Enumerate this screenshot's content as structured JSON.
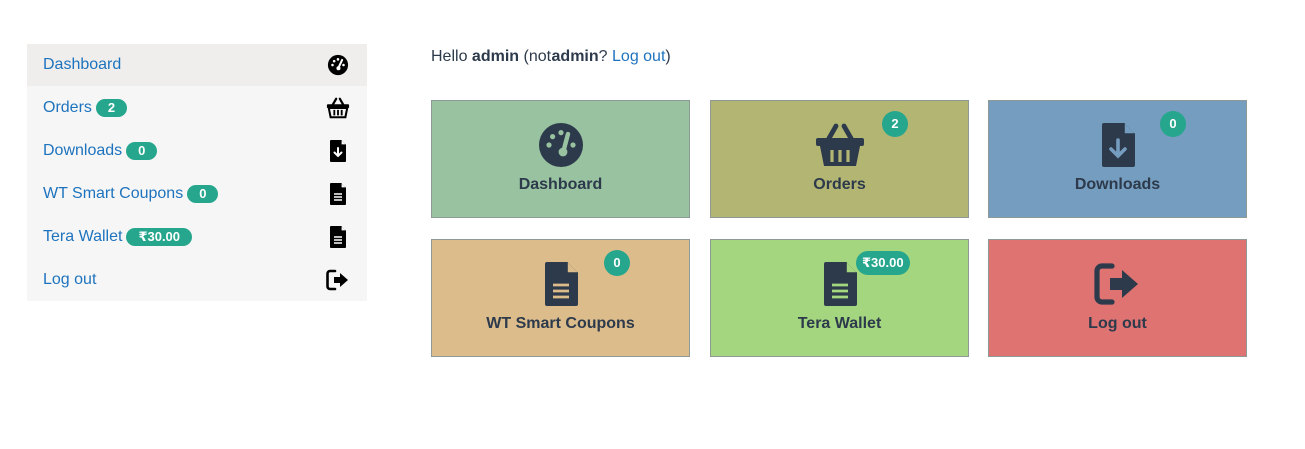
{
  "sidebar": {
    "items": [
      {
        "label": "Dashboard",
        "icon": "dashboard-gauge-icon"
      },
      {
        "label": "Orders",
        "badge": "2",
        "icon": "basket-icon"
      },
      {
        "label": "Downloads",
        "badge": "0",
        "icon": "file-download-icon"
      },
      {
        "label": "WT Smart Coupons",
        "badge": "0",
        "icon": "file-text-icon"
      },
      {
        "label": "Tera Wallet",
        "badge": "₹30.00",
        "icon": "file-text-icon"
      },
      {
        "label": "Log out",
        "icon": "sign-out-icon"
      }
    ]
  },
  "greeting": {
    "hello": "Hello",
    "user": "admin",
    "not_prefix": "(not",
    "not_user": "admin",
    "question": "?",
    "logout_link": "Log out",
    "close_paren": ")"
  },
  "tiles": [
    {
      "label": "Dashboard",
      "color": "#98c2a0",
      "icon": "dashboard-gauge-icon"
    },
    {
      "label": "Orders",
      "badge": "2",
      "color": "#b3b573",
      "icon": "basket-icon"
    },
    {
      "label": "Downloads",
      "badge": "0",
      "color": "#759dbf",
      "icon": "file-download-icon"
    },
    {
      "label": "WT Smart Coupons",
      "badge": "0",
      "color": "#dcbc8b",
      "icon": "file-text-icon"
    },
    {
      "label": "Tera Wallet",
      "badge": "₹30.00",
      "color": "#a4d67f",
      "icon": "file-text-icon"
    },
    {
      "label": "Log out",
      "color": "#de7372",
      "icon": "sign-out-icon"
    }
  ],
  "colors": {
    "link": "#1e73be",
    "badge": "#26a68d",
    "text": "#2d3a4b",
    "sidebar_bg": "#f6f6f6"
  }
}
